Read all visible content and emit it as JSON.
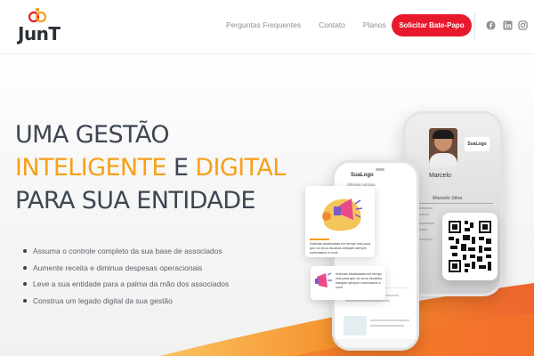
{
  "brand": {
    "name": "JunT"
  },
  "nav": {
    "items": [
      "Perguntas Frequentes",
      "Contato",
      "Planos"
    ],
    "cta_label": "Solicitar Bate-Papo"
  },
  "social": [
    "facebook-icon",
    "linkedin-icon",
    "instagram-icon"
  ],
  "hero": {
    "line1": "UMA GESTÃO",
    "line2_a": "INTELIGENTE",
    "line2_b": " E ",
    "line2_c": "DIGITAL",
    "line3": "PARA SUA ENTIDADE",
    "bullets": [
      "Assuma o controle completo da sua base de associados",
      "Aumente receita e diminua despesas operacionais",
      "Leve a sua entidade para a palma da mão dos associados",
      "Construa um legado digital da sua gestão"
    ]
  },
  "mockup": {
    "card_logo": "SuaLogo",
    "member_name": "Marcelo",
    "member_full": "Marcelo Silva",
    "front_logo": "SuaLogo",
    "front_tab": "Últimas notícias",
    "news_1": "Notícias atualizadas em tempo real para que os seus usuários estejam sempre conectados a você",
    "news_2": "Notícias atualizadas em tempo real para que os seus usuários estejam sempre conectados a você"
  },
  "colors": {
    "accent": "#f6a01a",
    "brand_red": "#e8192c",
    "text_dark": "#3e4653"
  }
}
